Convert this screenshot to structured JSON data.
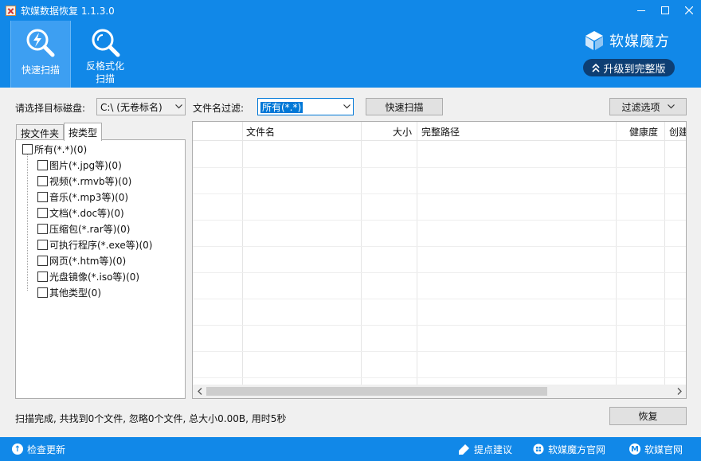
{
  "window": {
    "title": "软媒数据恢复 1.1.3.0"
  },
  "toolbar": {
    "quick_scan_label": "快速扫描",
    "format_scan_line1": "反格式化",
    "format_scan_line2": "扫描"
  },
  "brand": {
    "name": "软媒魔方",
    "upgrade_label": "升级到完整版"
  },
  "controls": {
    "disk_label": "请选择目标磁盘:",
    "disk_value": "C:\\  (无卷标名)",
    "filter_label": "文件名过滤:",
    "filter_value": "所有(*.*)",
    "scan_button": "快速扫描",
    "filter_options_button": "过滤选项",
    "restore_button": "恢复"
  },
  "tabs": [
    {
      "label": "按文件夹"
    },
    {
      "label": "按类型"
    }
  ],
  "tree": {
    "root": "所有(*.*)(0)",
    "items": [
      "图片(*.jpg等)(0)",
      "视频(*.rmvb等)(0)",
      "音乐(*.mp3等)(0)",
      "文档(*.doc等)(0)",
      "压缩包(*.rar等)(0)",
      "可执行程序(*.exe等)(0)",
      "网页(*.htm等)(0)",
      "光盘镜像(*.iso等)(0)",
      "其他类型(0)"
    ]
  },
  "table": {
    "columns": [
      "文件名",
      "大小",
      "完整路径",
      "健康度",
      "创建"
    ]
  },
  "status": {
    "text": "扫描完成, 共找到0个文件, 忽略0个文件, 总大小0.00B, 用时5秒"
  },
  "footer": {
    "update": "检查更新",
    "feedback": "提点建议",
    "mofang_site": "软媒魔方官网",
    "ruanmei_site": "软媒官网"
  },
  "colors": {
    "accent": "#1188e8",
    "upgrade_bg": "#0d3e73"
  }
}
